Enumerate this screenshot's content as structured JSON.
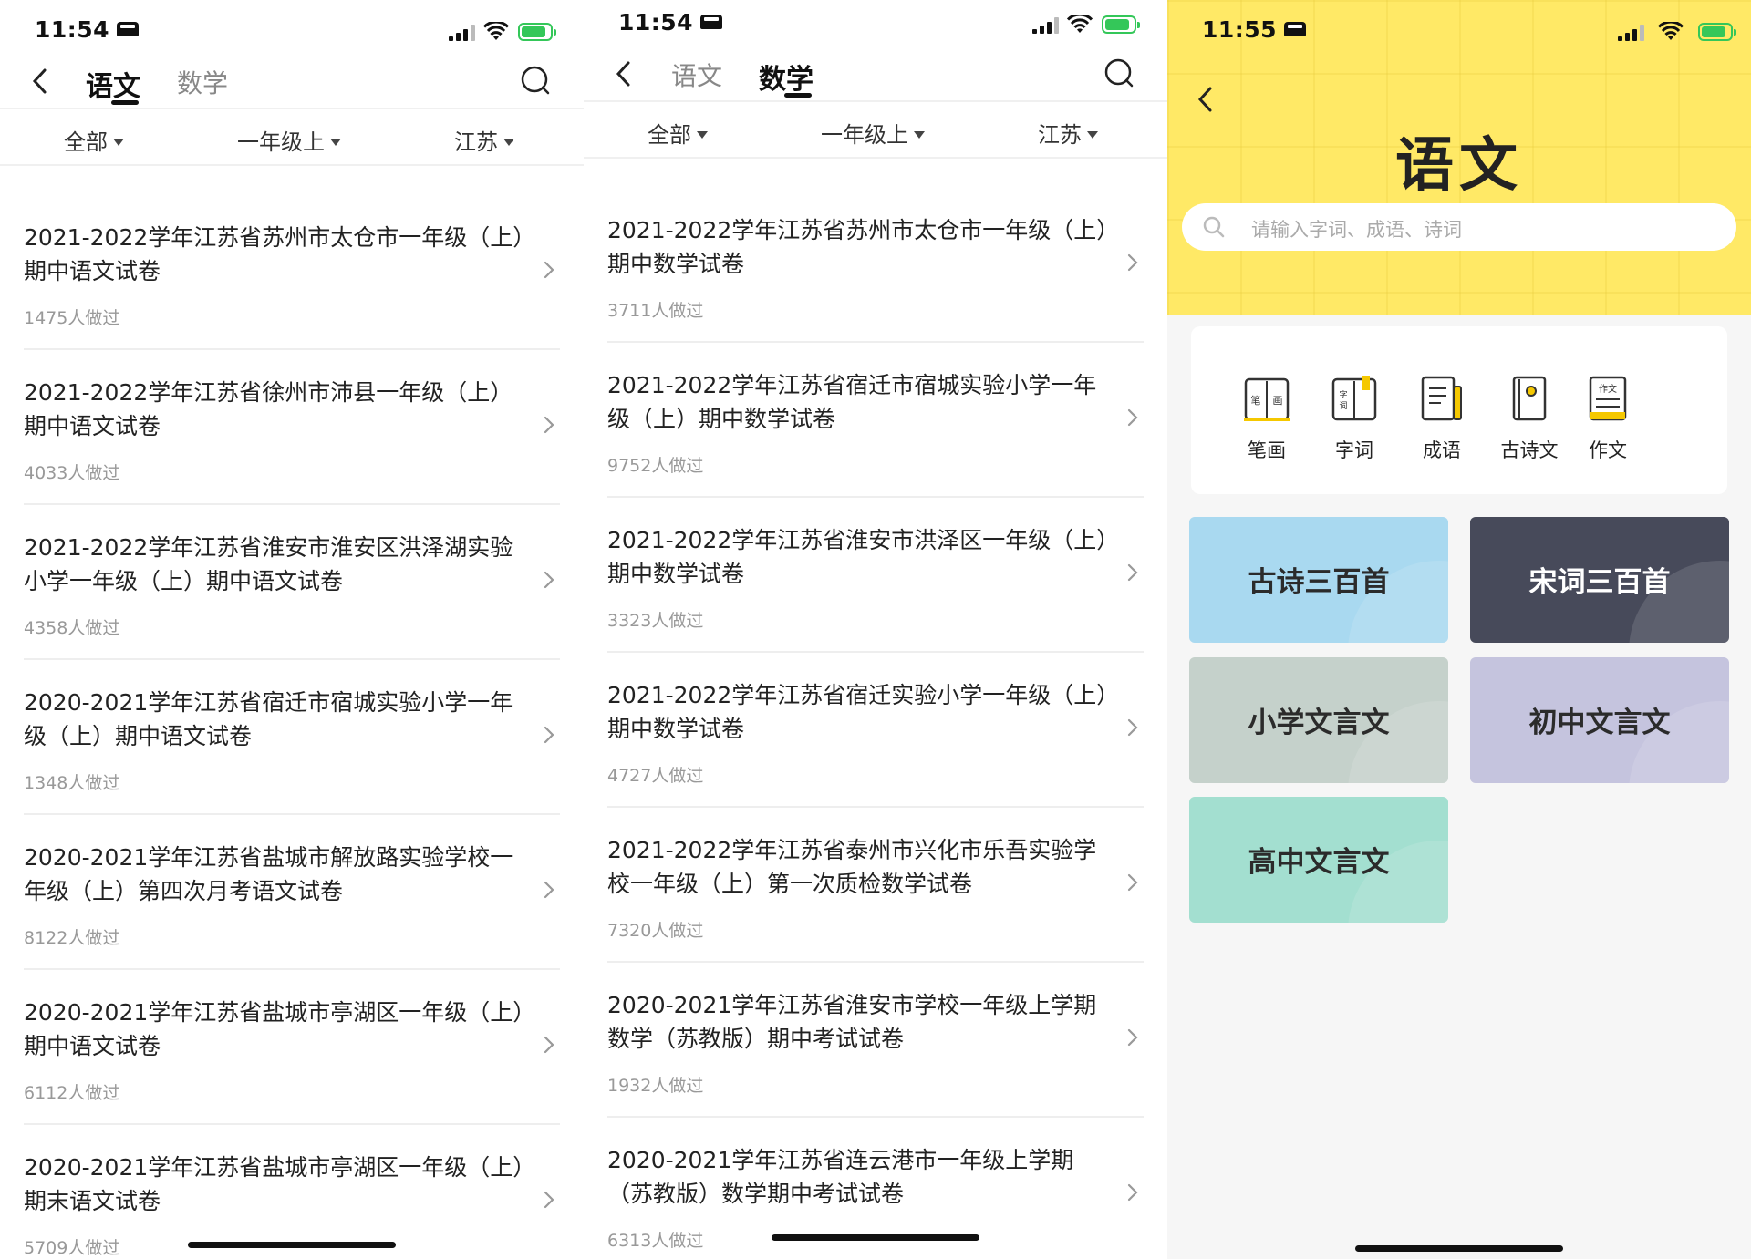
{
  "panels": [
    {
      "time": "11:54",
      "tabs": [
        "语文",
        "数学"
      ],
      "active_tab": 0,
      "filters": [
        "全部",
        "一年级上",
        "江苏"
      ],
      "items": [
        {
          "title": "2021-2022学年江苏省苏州市太仓市一年级（上）期中语文试卷",
          "count": "1475人做过"
        },
        {
          "title": "2021-2022学年江苏省徐州市沛县一年级（上）期中语文试卷",
          "count": "4033人做过"
        },
        {
          "title": "2021-2022学年江苏省淮安市淮安区洪泽湖实验小学一年级（上）期中语文试卷",
          "count": "4358人做过"
        },
        {
          "title": "2020-2021学年江苏省宿迁市宿城实验小学一年级（上）期中语文试卷",
          "count": "1348人做过"
        },
        {
          "title": "2020-2021学年江苏省盐城市解放路实验学校一年级（上）第四次月考语文试卷",
          "count": "8122人做过"
        },
        {
          "title": "2020-2021学年江苏省盐城市亭湖区一年级（上）期中语文试卷",
          "count": "6112人做过"
        },
        {
          "title": "2020-2021学年江苏省盐城市亭湖区一年级（上）期末语文试卷",
          "count": "5709人做过"
        }
      ]
    },
    {
      "time": "11:54",
      "tabs": [
        "语文",
        "数学"
      ],
      "active_tab": 1,
      "filters": [
        "全部",
        "一年级上",
        "江苏"
      ],
      "items": [
        {
          "title": "2021-2022学年江苏省苏州市太仓市一年级（上）期中数学试卷",
          "count": "3711人做过"
        },
        {
          "title": "2021-2022学年江苏省宿迁市宿城实验小学一年级（上）期中数学试卷",
          "count": "9752人做过"
        },
        {
          "title": "2021-2022学年江苏省淮安市洪泽区一年级（上）期中数学试卷",
          "count": "3323人做过"
        },
        {
          "title": "2021-2022学年江苏省宿迁实验小学一年级（上）期中数学试卷",
          "count": "4727人做过"
        },
        {
          "title": "2021-2022学年江苏省泰州市兴化市乐吾实验学校一年级（上）第一次质检数学试卷",
          "count": "7320人做过"
        },
        {
          "title": "2020-2021学年江苏省淮安市学校一年级上学期数学（苏教版）期中考试试卷",
          "count": "1932人做过"
        },
        {
          "title": "2020-2021学年江苏省连云港市一年级上学期（苏教版）数学期中考试试卷",
          "count": "6313人做过"
        }
      ]
    }
  ],
  "chinese_home": {
    "time": "11:55",
    "title": "语文",
    "search_placeholder": "请输入字词、成语、诗词",
    "tools": [
      {
        "label": "笔画",
        "icon": "stroke-book-icon"
      },
      {
        "label": "字词",
        "icon": "word-book-icon"
      },
      {
        "label": "成语",
        "icon": "idiom-doc-icon"
      },
      {
        "label": "古诗文",
        "icon": "poem-book-icon"
      },
      {
        "label": "作文",
        "icon": "essay-doc-icon"
      }
    ],
    "cards": [
      {
        "label": "古诗三百首",
        "bg": "#a9d9f0",
        "fg": "#2b2b2b"
      },
      {
        "label": "宋词三百首",
        "bg": "#474a5a",
        "fg": "#ffffff"
      },
      {
        "label": "小学文言文",
        "bg": "#c5d1cb",
        "fg": "#2b2b2b"
      },
      {
        "label": "初中文言文",
        "bg": "#c5c4de",
        "fg": "#2b2b2b"
      },
      {
        "label": "高中文言文",
        "bg": "#a3dfd0",
        "fg": "#2b2b2b"
      }
    ]
  },
  "colors": {
    "accent_yellow": "#ffe966",
    "battery_green": "#34c759"
  }
}
